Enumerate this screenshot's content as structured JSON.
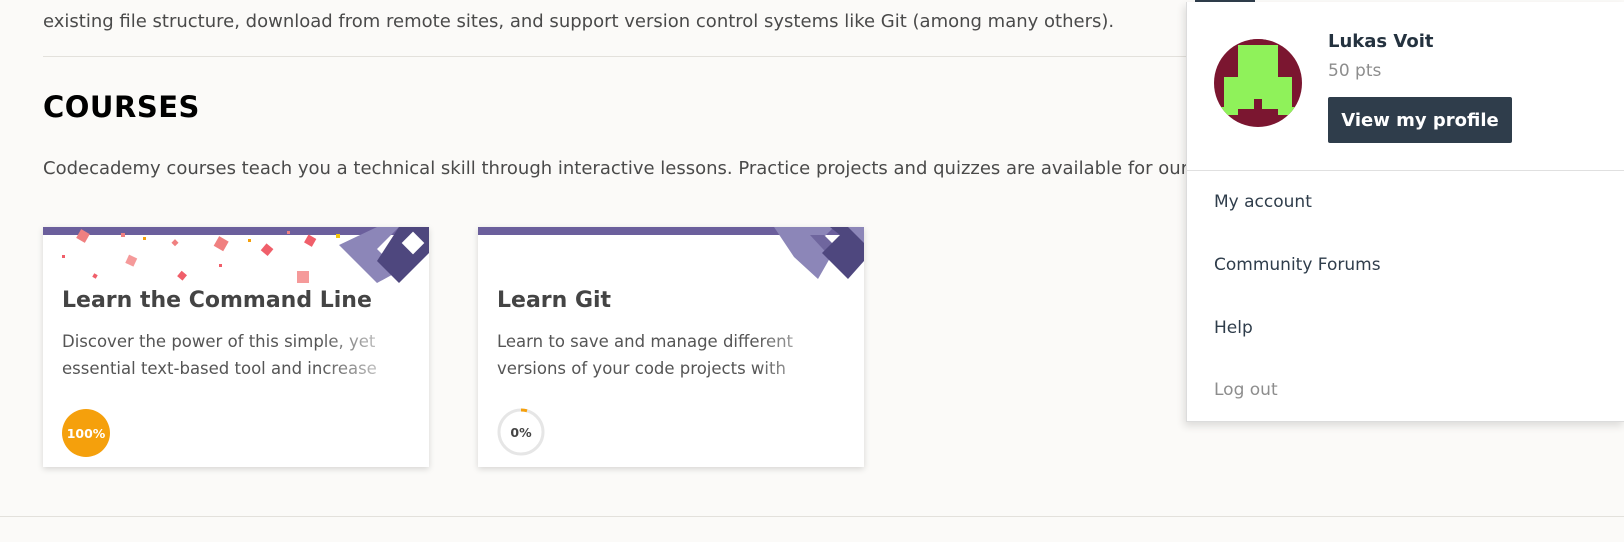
{
  "intro": {
    "text": "existing file structure, download from remote sites, and support version control systems like Git (among many others)."
  },
  "courses_section": {
    "title": "COURSES",
    "description": "Codecademy courses teach you a technical skill through interactive lessons. Practice projects and quizzes are available for our Pro members."
  },
  "cards": [
    {
      "title": "Learn the Command Line",
      "description": "Discover the power of this simple, yet essential text-based tool and increase your productivity.",
      "progress_label": "100%",
      "progress": 1.0
    },
    {
      "title": "Learn Git",
      "description": "Learn to save and manage different versions of your code projects with this essential tool.",
      "progress_label": "0%",
      "progress": 0.0
    }
  ],
  "user_menu": {
    "name": "Lukas Voit",
    "points": "50 pts",
    "profile_button": "View my profile",
    "items": [
      {
        "label": "My account"
      },
      {
        "label": "Community Forums"
      },
      {
        "label": "Help"
      },
      {
        "label": "Log out"
      }
    ]
  },
  "colors": {
    "accent_purple": "#6b5f9c",
    "progress_orange": "#f5a00c",
    "button_navy": "#2f3d4b",
    "avatar_bg": "#7b1630",
    "avatar_fg": "#8ff25a"
  }
}
